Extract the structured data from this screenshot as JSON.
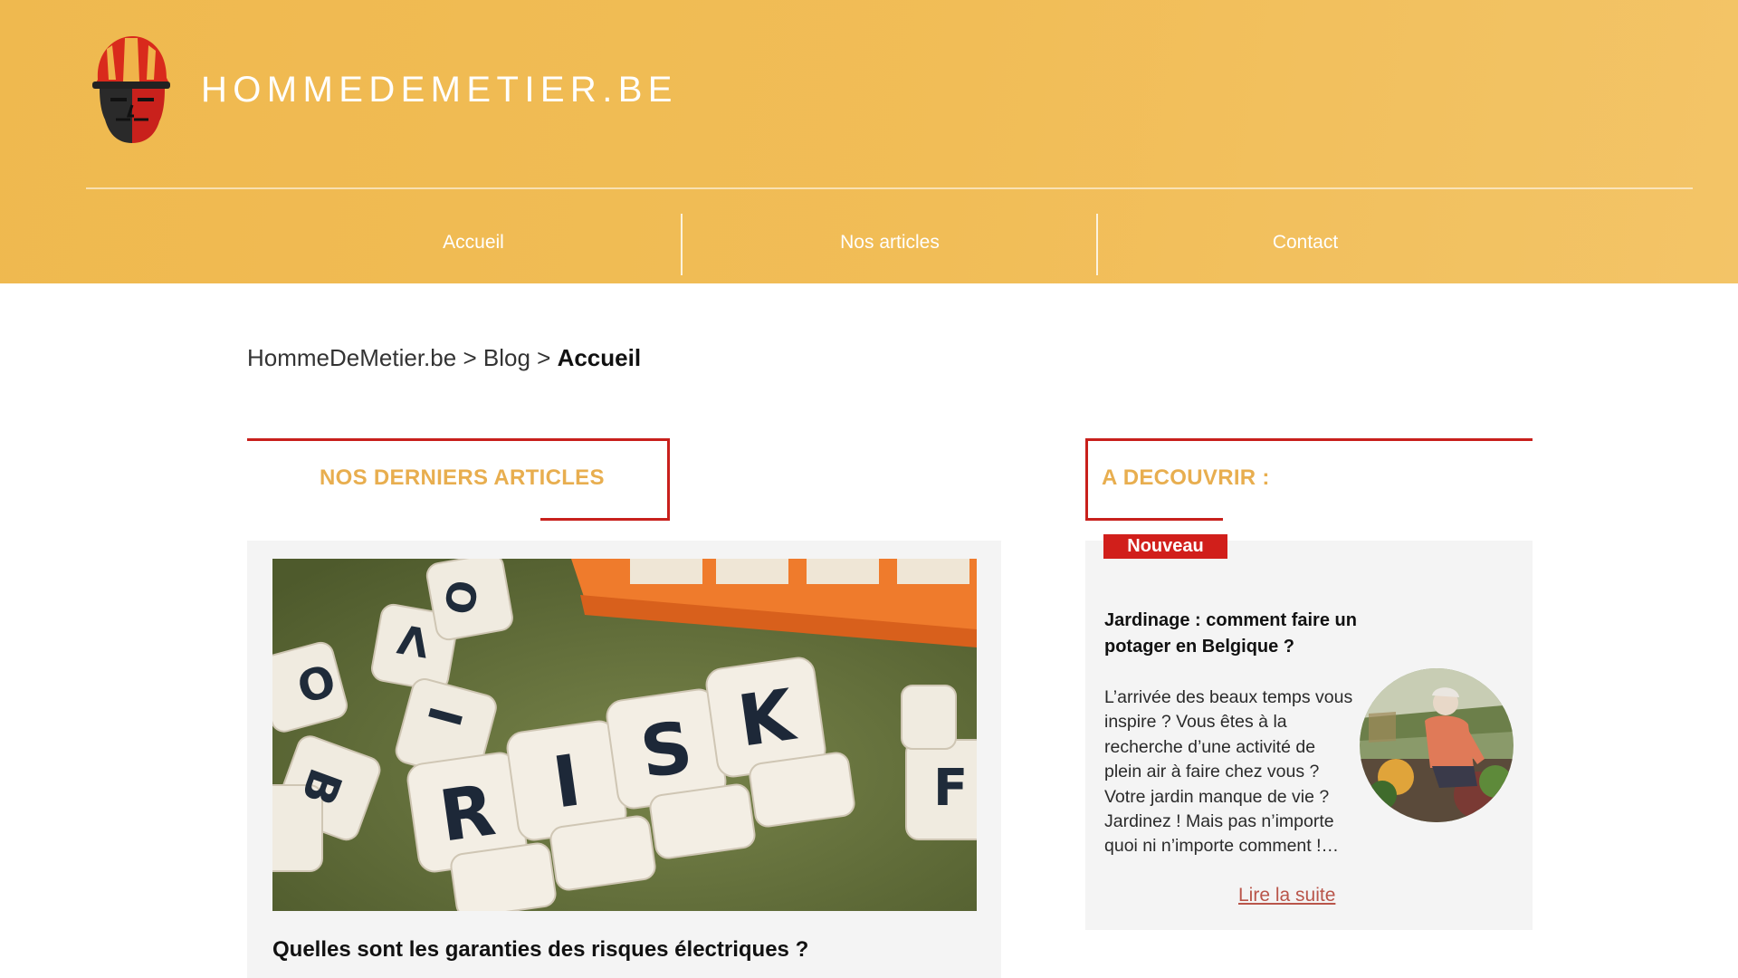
{
  "site": {
    "title": "HOMMEDEMETIER.BE",
    "logo_icon": "worker-hardhat-logo",
    "brand_color": "#efb94f",
    "accent_red": "#c8201c",
    "heading_color": "#e8ae4f"
  },
  "nav": {
    "items": [
      {
        "label": "Accueil"
      },
      {
        "label": "Nos articles"
      },
      {
        "label": "Contact"
      }
    ]
  },
  "breadcrumb": {
    "home": "HommeDeMetier.be",
    "sep1": ">",
    "blog": "Blog",
    "sep2": ">",
    "current": "Accueil"
  },
  "main": {
    "section_title": "NOS DERNIERS ARTICLES",
    "article": {
      "image_icon": "risk-dice-photo",
      "image_letters": [
        "R",
        "I",
        "S",
        "K"
      ],
      "title": "Quelles sont les garanties des risques électriques ?"
    }
  },
  "sidebar": {
    "section_title": "A DECOUVRIR :",
    "badge": "Nouveau",
    "title": "Jardinage : comment faire un potager en Belgique ?",
    "excerpt": "L’arrivée des beaux temps vous inspire ? Vous êtes à la recherche d’une activité de plein air à faire chez vous ? Votre jardin manque de vie ? Jardinez ! Mais pas n’importe quoi ni n’importe comment !…",
    "read_more": "Lire la suite",
    "photo_icon": "gardening-photo"
  }
}
